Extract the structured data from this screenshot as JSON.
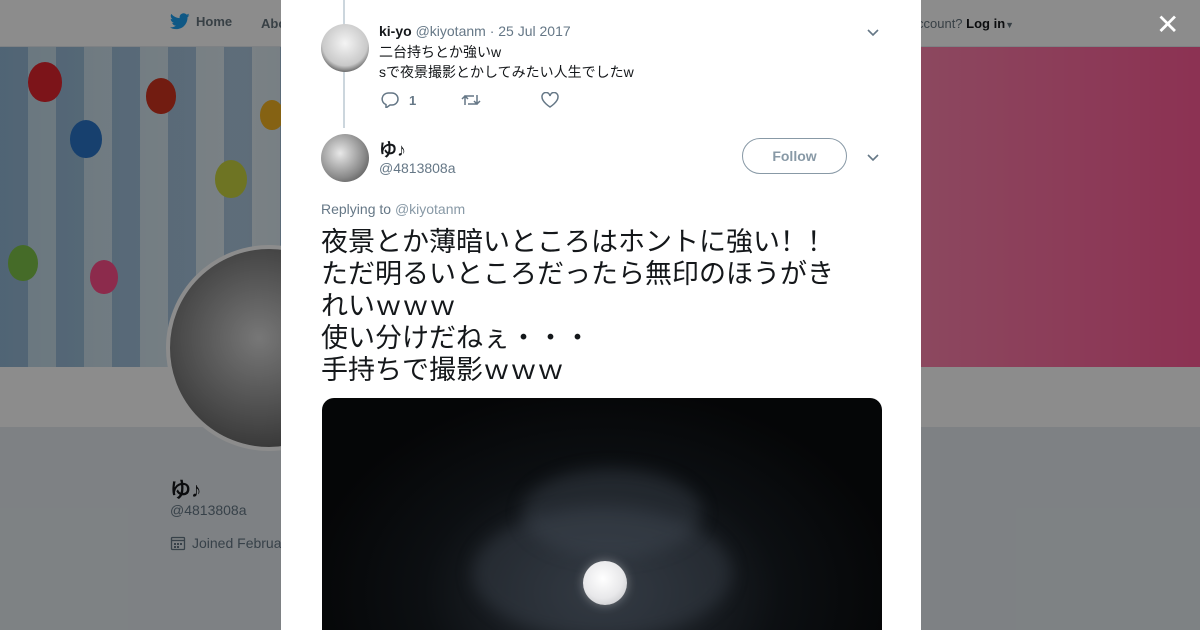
{
  "topnav": {
    "home_label": "Home",
    "about_label": "Abo",
    "account_text": "ccount?",
    "login_label": "Log in"
  },
  "profile": {
    "name": "ゆ♪",
    "handle": "@4813808a",
    "joined": "Joined Februa"
  },
  "modal": {
    "close_icon": "close-icon",
    "parent_tweet": {
      "name": "ki-yo",
      "handle": "@kiyotanm",
      "separator": "·",
      "date": "25 Jul 2017",
      "lines": [
        "二台持ちとか強いw",
        "sで夜景撮影とかしてみたい人生でしたw"
      ],
      "reply_count": "1"
    },
    "main_tweet": {
      "name": "ゆ♪",
      "handle": "@4813808a",
      "follow_label": "Follow",
      "replying_prefix": "Replying to",
      "replying_to": "@kiyotanm",
      "lines": [
        "夜景とか薄暗いところはホントに強い！！",
        "ただ明るいところだったら無印のほうがき",
        "れいｗｗｗ",
        "使い分けだねぇ・・・",
        "手持ちで撮影ｗｗｗ"
      ]
    }
  },
  "colors": {
    "twitter_blue": "#1da1f2",
    "text_primary": "#14171a",
    "text_secondary": "#657786"
  }
}
